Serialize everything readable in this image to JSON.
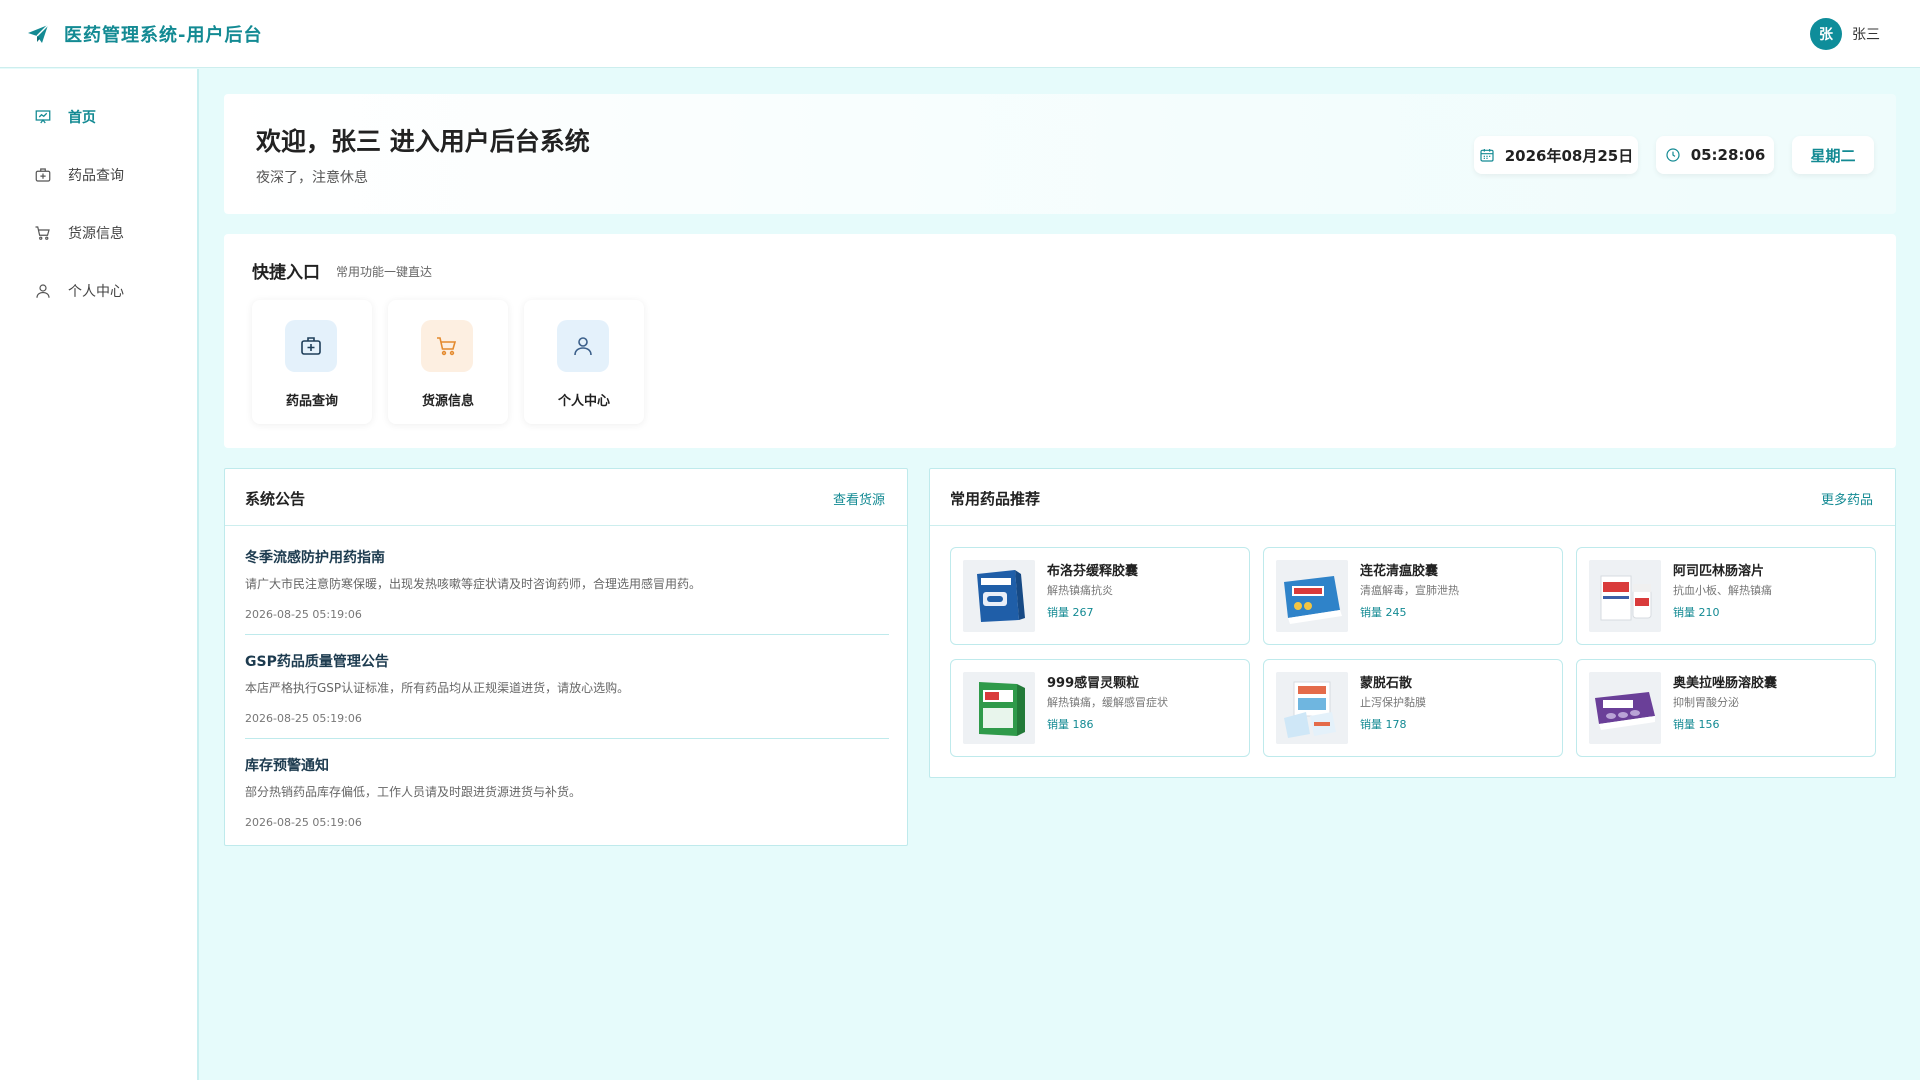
{
  "header": {
    "title": "医药管理系统-用户后台",
    "avatar_letter": "张",
    "user_name": "张三"
  },
  "sidebar": {
    "items": [
      {
        "label": "首页",
        "icon": "presentation-icon",
        "active": true
      },
      {
        "label": "药品查询",
        "icon": "medkit-icon",
        "active": false
      },
      {
        "label": "货源信息",
        "icon": "cart-icon",
        "active": false
      },
      {
        "label": "个人中心",
        "icon": "user-icon",
        "active": false
      }
    ]
  },
  "welcome": {
    "title": "欢迎，张三 进入用户后台系统",
    "subtitle": "夜深了，注意休息",
    "date": "2026年08月25日",
    "time": "05:28:06",
    "weekday": "星期二"
  },
  "quick": {
    "title": "快捷入口",
    "subtitle": "常用功能一键直达",
    "items": [
      {
        "label": "药品查询",
        "icon": "medkit-icon"
      },
      {
        "label": "货源信息",
        "icon": "cart-icon"
      },
      {
        "label": "个人中心",
        "icon": "user-icon"
      }
    ]
  },
  "notice": {
    "title": "系统公告",
    "link": "查看货源",
    "items": [
      {
        "title": "冬季流感防护用药指南",
        "text": "请广大市民注意防寒保暖，出现发热咳嗽等症状请及时咨询药师，合理选用感冒用药。",
        "time": "2026-08-25 05:19:06"
      },
      {
        "title": "GSP药品质量管理公告",
        "text": "本店严格执行GSP认证标准，所有药品均从正规渠道进货，请放心选购。",
        "time": "2026-08-25 05:19:06"
      },
      {
        "title": "库存预警通知",
        "text": "部分热销药品库存偏低，工作人员请及时跟进货源进货与补货。",
        "time": "2026-08-25 05:19:06"
      }
    ]
  },
  "drugs": {
    "title": "常用药品推荐",
    "link": "更多药品",
    "items": [
      {
        "name": "布洛芬缓释胶囊",
        "desc": "解热镇痛抗炎",
        "sales": "销量 267"
      },
      {
        "name": "连花清瘟胶囊",
        "desc": "清瘟解毒，宣肺泄热",
        "sales": "销量 245"
      },
      {
        "name": "阿司匹林肠溶片",
        "desc": "抗血小板、解热镇痛",
        "sales": "销量 210"
      },
      {
        "name": "999感冒灵颗粒",
        "desc": "解热镇痛，缓解感冒症状",
        "sales": "销量 186"
      },
      {
        "name": "蒙脱石散",
        "desc": "止泻保护黏膜",
        "sales": "销量 178"
      },
      {
        "name": "奥美拉唑肠溶胶囊",
        "desc": "抑制胃酸分泌",
        "sales": "销量 156"
      }
    ]
  },
  "colors": {
    "accent": "#138a93",
    "background": "#e6fbfb",
    "border": "#bfeaec"
  }
}
